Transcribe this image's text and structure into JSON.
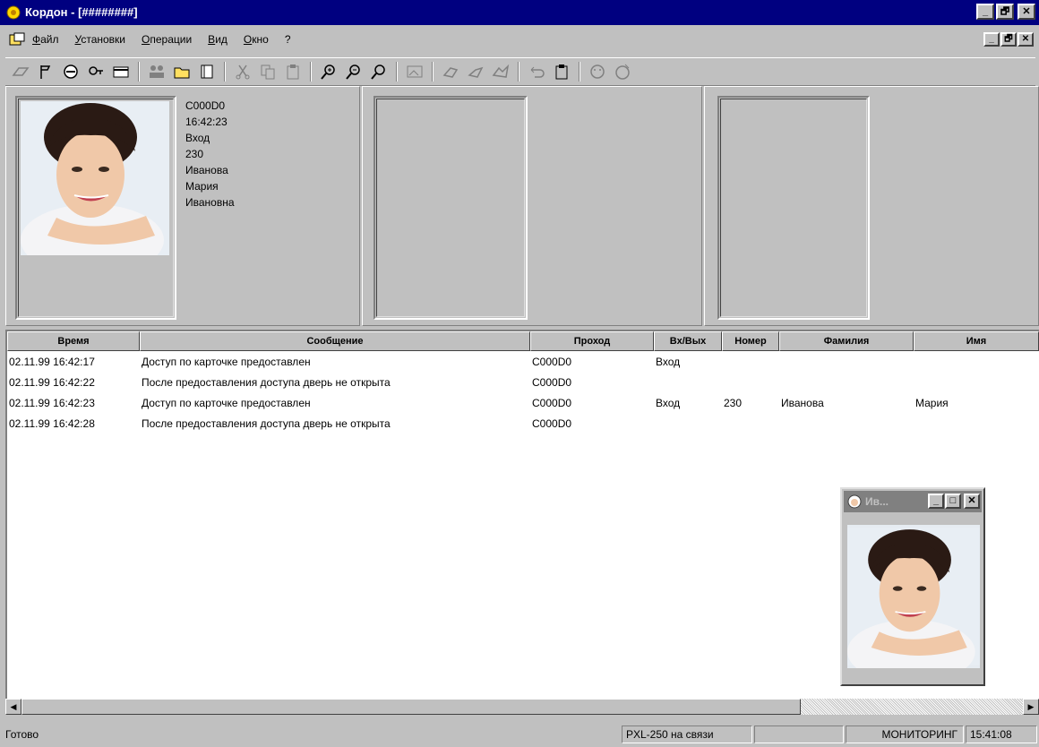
{
  "window": {
    "title": "Кордон - [########]",
    "min_label": "_",
    "max_label": "🗗",
    "close_label": "✕"
  },
  "menu": {
    "items": [
      "Файл",
      "Установки",
      "Операции",
      "Вид",
      "Окно",
      "?"
    ]
  },
  "toolbar": {
    "icons": [
      "gate-icon",
      "flag-icon",
      "no-entry-icon",
      "key-icon",
      "card-icon",
      "people-icon",
      "folder-icon",
      "book-icon",
      "cut-icon",
      "copy-icon",
      "paste-icon",
      "zoom-in-icon",
      "zoom-out-icon",
      "zoom-icon",
      "image-icon",
      "hand-icon",
      "hand-right-icon",
      "hands-icon",
      "undo-icon",
      "paste-icon",
      "face-icon",
      "face-info-icon"
    ]
  },
  "event_panel": {
    "device": "C000D0",
    "time": "16:42:23",
    "direction": "Вход",
    "number": "230",
    "last_name": "Иванова",
    "first_name": "Мария",
    "patronymic": "Ивановна"
  },
  "table": {
    "columns": [
      "Время",
      "Сообщение",
      "Проход",
      "Вх/Вых",
      "Номер",
      "Фамилия",
      "Имя"
    ],
    "rows": [
      [
        "02.11.99 16:42:17",
        "Доступ по карточке предоставлен",
        "C000D0",
        "Вход",
        "",
        "",
        ""
      ],
      [
        "02.11.99 16:42:22",
        "После предоставления доступа дверь не открыта",
        "C000D0",
        "",
        "",
        "",
        ""
      ],
      [
        "02.11.99 16:42:23",
        "Доступ по карточке предоставлен",
        "C000D0",
        "Вход",
        "230",
        "Иванова",
        "Мария"
      ],
      [
        "02.11.99 16:42:28",
        "После предоставления доступа дверь не открыта",
        "C000D0",
        "",
        "",
        "",
        ""
      ]
    ]
  },
  "mini_window": {
    "title": "Ив...",
    "min_label": "_",
    "max_label": "□",
    "close_label": "✕"
  },
  "status": {
    "ready": "Готово",
    "connection": "PXL-250 на связи",
    "mode": "МОНИТОРИНГ",
    "clock": "15:41:08"
  },
  "colors": {
    "title_active": "#000080",
    "title_inactive": "#808080",
    "face": "#c0c0c0"
  }
}
